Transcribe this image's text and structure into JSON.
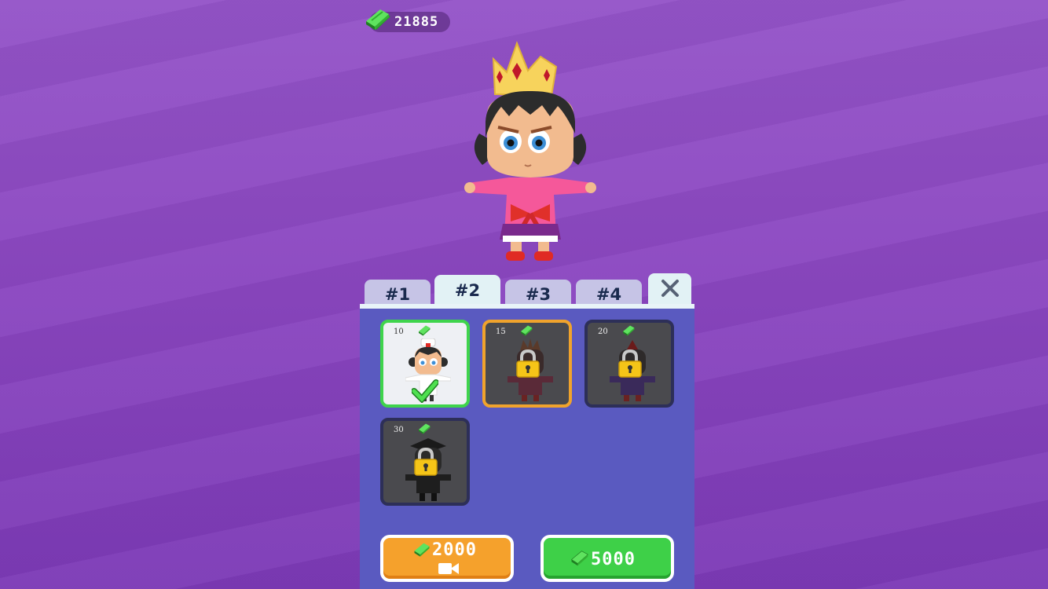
{
  "currency": {
    "icon": "cash-icon",
    "value": "21885"
  },
  "tabs": [
    {
      "label": "#1",
      "active": false
    },
    {
      "label": "#2",
      "active": true
    },
    {
      "label": "#3",
      "active": false
    },
    {
      "label": "#4",
      "active": false
    }
  ],
  "close_icon": "close-icon",
  "items": [
    {
      "price": "10",
      "state": "equipped"
    },
    {
      "price": "15",
      "state": "locked"
    },
    {
      "price": "20",
      "state": "locked"
    },
    {
      "price": "30",
      "state": "locked"
    }
  ],
  "buttons": {
    "video_unlock": {
      "amount": "2000",
      "icon": "video-camera-icon",
      "color": "#f5a12c"
    },
    "buy": {
      "amount": "5000",
      "color": "#3ed048"
    }
  },
  "colors": {
    "background": "#8a46c0",
    "panel": "#5a5ac0",
    "selected_border": "#3fd44c",
    "highlight_border": "#f0a32c"
  }
}
